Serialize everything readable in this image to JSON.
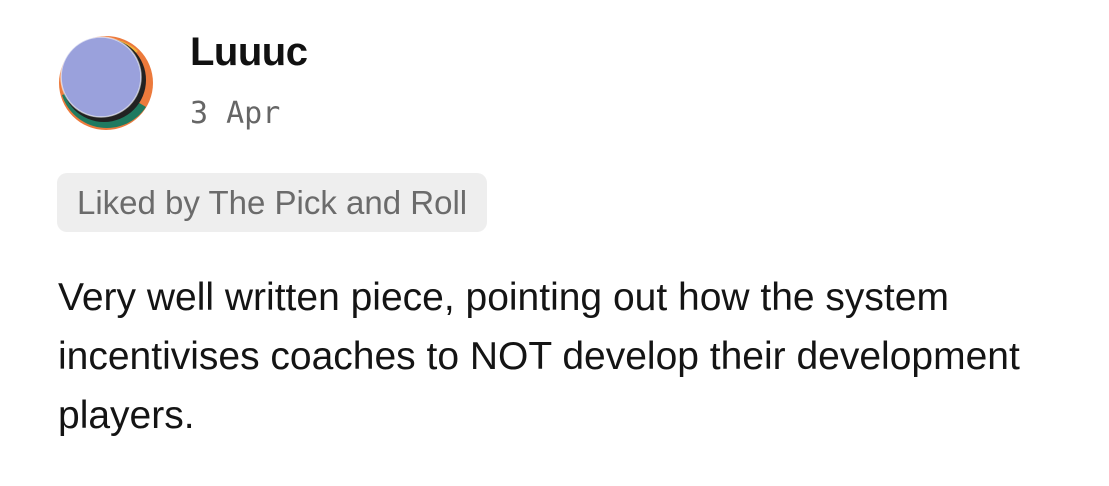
{
  "comment": {
    "author": "Luuuc",
    "date": "3 Apr",
    "liked_by": "Liked by The Pick and Roll",
    "text": "Very well written piece, pointing out how the system incentivises coaches to NOT develop their development players.",
    "avatar_icon": "abstract-circle-avatar-icon",
    "colors": {
      "avatar_main": "#9aa1dc",
      "avatar_yellow": "#f1b33a",
      "avatar_orange": "#ec7a3c",
      "avatar_green": "#1f7a60",
      "avatar_dark": "#222222",
      "liked_background": "#eeeeee",
      "date_text": "#666666"
    }
  }
}
